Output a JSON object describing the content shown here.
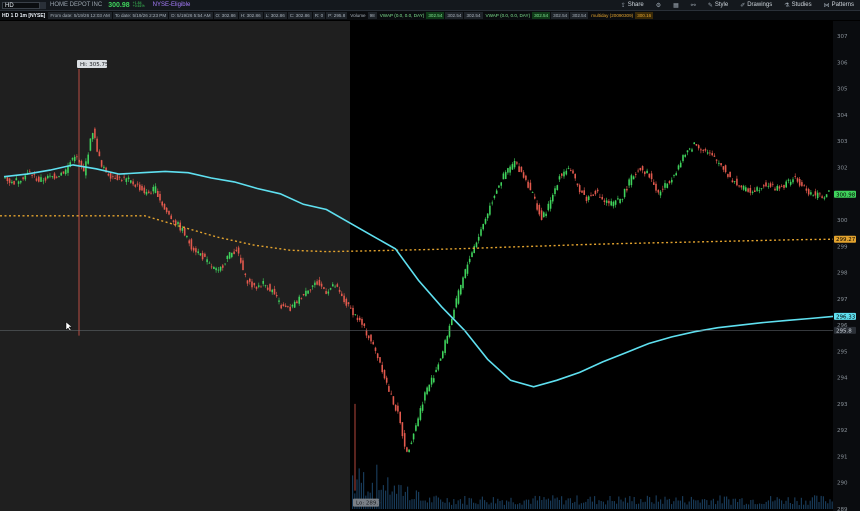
{
  "toolbar": {
    "symbol": "HD",
    "company": "HOME DEPOT INC",
    "last_price": "300.98",
    "change_line1": "+1.84",
    "change_line2": "+0.61%",
    "exchange_note": "NYSE-Eligible",
    "buttons": [
      {
        "label": "Share",
        "icon": "share-icon"
      },
      {
        "label": "",
        "icon": "gear-icon"
      },
      {
        "label": "",
        "icon": "grid-icon"
      },
      {
        "label": "",
        "icon": "link-icon"
      },
      {
        "label": "Style",
        "icon": "style-icon"
      },
      {
        "label": "Drawings",
        "icon": "pencil-icon"
      },
      {
        "label": "Studies",
        "icon": "flask-icon"
      },
      {
        "label": "Patterns",
        "icon": "patterns-icon"
      }
    ]
  },
  "header": {
    "symbol_timeframe": "HD 1 D 1m [NYSE]",
    "from_date": "From date: 5/19/26 12:03 AM",
    "to_date": "To date: 5/19/26 2:23 PM",
    "d_date": "D: 5/19/26 5:54 AM",
    "o": "O: 302.86",
    "h": "H: 302.86",
    "l": "L: 302.86",
    "c": "C: 302.86",
    "r": "R: 0",
    "price_field": "P: 295.8",
    "volume_label": "Volume",
    "volume_value": "98",
    "vwap1_label": "VWAP (0.0, 0.0, DAY)",
    "vwap1_value": "302.54",
    "vwap1_extra": [
      "302.54",
      "302.54"
    ],
    "vwap2_label": "VWAP (0.0, 0.0, DAY)",
    "vwap2_value": "302.54",
    "vwap2_extra": [
      "302.54",
      "302.54"
    ],
    "multiday_label": "multiday (20090309)",
    "multiday_value": "300.16"
  },
  "chart": {
    "hi_label": "Hi: 305.75",
    "lo_label": "Lo: 289.7",
    "y_ticks": [
      "307",
      "306",
      "305",
      "304",
      "303",
      "302",
      "301",
      "300",
      "299",
      "298",
      "297",
      "296",
      "295",
      "294",
      "293",
      "292",
      "291",
      "290",
      "289"
    ],
    "price_badges": [
      {
        "text": "300.98",
        "color": "#3fd35c",
        "text_color": "#000000"
      },
      {
        "text": "299.27",
        "color": "#e3a32e",
        "text_color": "#000000"
      },
      {
        "text": "296.33",
        "color": "#5fe0f0",
        "text_color": "#000000"
      },
      {
        "text": "295.8",
        "color": "#2a2f36",
        "text_color": "#cfd6dd"
      }
    ],
    "colors": {
      "premarket_bg": "#1f1f1f",
      "session_bg": "#000000",
      "up": "#3fd35c",
      "down": "#e2594d",
      "vwap": "#5fe0f0",
      "multiday": "#e3a32e",
      "volume": "#2b6aa0"
    }
  },
  "chart_data": {
    "type": "line",
    "title": "HD 1 D 1m [NYSE]",
    "y_axis_range": [
      289,
      307.5
    ],
    "grid": false,
    "series": [
      {
        "name": "Price",
        "style": "candles",
        "values": [
          301.7,
          301.4,
          301.6,
          301.8,
          301.5,
          301.6,
          301.7,
          301.9,
          302.5,
          301.8,
          303.4,
          302.0,
          301.7,
          301.6,
          301.5,
          301.3,
          301.0,
          301.2,
          300.4,
          300.0,
          299.6,
          299.0,
          298.7,
          298.3,
          298.0,
          298.6,
          298.9,
          297.8,
          297.4,
          297.6,
          297.3,
          296.7,
          296.6,
          297.0,
          297.4,
          297.6,
          297.3,
          297.5,
          296.9,
          296.5,
          296.0,
          295.4,
          294.6,
          293.5,
          292.6,
          291.1,
          292.2,
          293.4,
          294.1,
          295.0,
          296.3,
          297.5,
          298.6,
          299.4,
          300.3,
          301.2,
          301.8,
          302.2,
          301.7,
          301.0,
          300.0,
          300.7,
          301.7,
          302.0,
          301.3,
          300.8,
          301.1,
          300.7,
          300.6,
          300.9,
          301.6,
          302.0,
          301.7,
          301.0,
          301.4,
          301.9,
          302.5,
          302.9,
          302.7,
          302.4,
          302.1,
          301.6,
          301.3,
          301.1,
          301.2,
          301.4,
          301.2,
          301.3,
          301.6,
          301.3,
          301.0,
          300.9,
          301.0
        ],
        "high": 305.75,
        "low": 289.7,
        "last": 300.98
      },
      {
        "name": "VWAP (0.0, 0.0, DAY)",
        "values": [
          301.65,
          301.75,
          301.9,
          302.1,
          301.95,
          301.75,
          301.8,
          301.85,
          301.8,
          301.6,
          301.45,
          301.2,
          301.0,
          300.6,
          300.4,
          299.9,
          299.4,
          298.9,
          297.7,
          296.7,
          295.8,
          294.7,
          293.9,
          293.65,
          293.9,
          294.2,
          294.6,
          294.95,
          295.3,
          295.55,
          295.75,
          295.9,
          296.0,
          296.1,
          296.18,
          296.25,
          296.33
        ],
        "last": 296.33
      },
      {
        "name": "multiday (20090309)",
        "values": [
          300.16,
          300.16,
          300.16,
          300.16,
          300.16,
          299.75,
          299.35,
          299.05,
          298.85,
          298.8,
          298.82,
          298.85,
          298.88,
          298.92,
          298.97,
          299.01,
          299.06,
          299.1,
          299.13,
          299.16,
          299.19,
          299.22,
          299.25,
          299.27
        ],
        "last": 299.27
      }
    ],
    "crosshair_price": 295.8
  }
}
